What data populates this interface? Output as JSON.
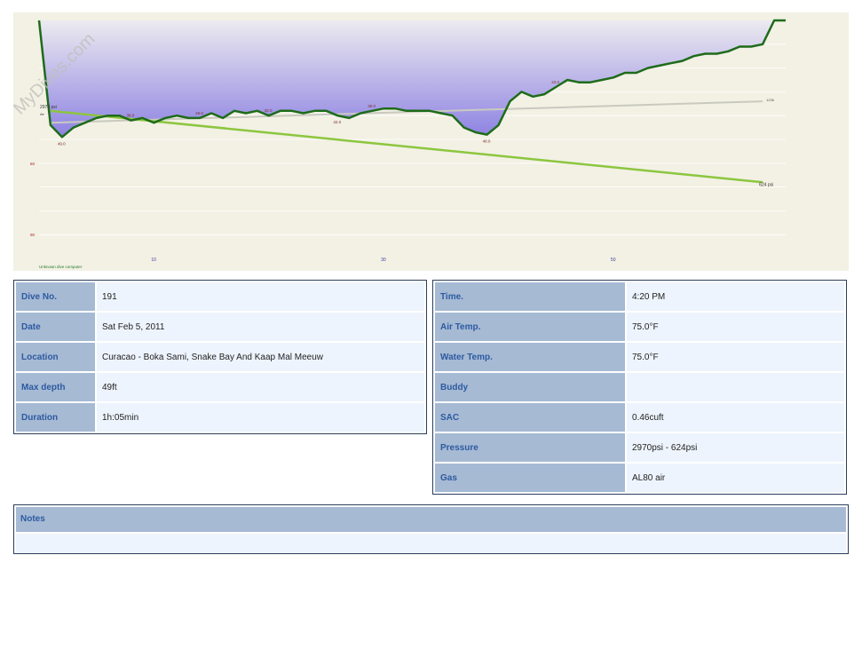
{
  "chart_data": {
    "type": "line",
    "title": "",
    "watermark": "MyDives.com",
    "device_label": "Unknown dive computer",
    "x_ticks": [
      "10",
      "30",
      "50"
    ],
    "y_ticks": [
      "60",
      "90"
    ],
    "depth_profile": {
      "x": [
        0,
        1,
        2,
        3,
        4,
        5,
        6,
        7,
        8,
        9,
        10,
        11,
        12,
        13,
        14,
        15,
        16,
        17,
        18,
        19,
        20,
        21,
        22,
        23,
        24,
        25,
        26,
        27,
        28,
        29,
        30,
        31,
        32,
        33,
        34,
        35,
        36,
        37,
        38,
        39,
        40,
        41,
        42,
        43,
        44,
        45,
        46,
        47,
        48,
        49,
        50,
        51,
        52,
        53,
        54,
        55,
        56,
        57,
        58,
        59,
        60,
        61,
        62,
        63,
        64,
        65
      ],
      "y": [
        0,
        44,
        49,
        45,
        43,
        41,
        40,
        40,
        42,
        41,
        43,
        41,
        40,
        41,
        41,
        39,
        41,
        38,
        39,
        38,
        40,
        38,
        38,
        39,
        38,
        38,
        40,
        41,
        39,
        38,
        37,
        37,
        38,
        38,
        38,
        39,
        40,
        45,
        47,
        48,
        44,
        34,
        30,
        32,
        31,
        28,
        25,
        26,
        26,
        25,
        24,
        22,
        22,
        20,
        19,
        18,
        17,
        15,
        14,
        14,
        13,
        11,
        11,
        10,
        0,
        0
      ]
    },
    "depth_labels": [
      "49.0",
      "38.0",
      "29.0",
      "32.0",
      "42.0",
      "30.0",
      "48.0",
      "22.0"
    ],
    "pressure": {
      "start_label": "2970 psi",
      "start_sub": "Air",
      "end_label": "624 psi"
    },
    "reference_label": "1236"
  },
  "left_table": [
    {
      "label": "Dive No.",
      "value": "191"
    },
    {
      "label": "Date",
      "value": "Sat Feb 5, 2011"
    },
    {
      "label": "Location",
      "value": "Curacao - Boka Sami, Snake Bay And Kaap Mal Meeuw"
    },
    {
      "label": "Max depth",
      "value": "49ft"
    },
    {
      "label": "Duration",
      "value": "1h:05min"
    }
  ],
  "right_table": [
    {
      "label": "Time.",
      "value": "4:20 PM"
    },
    {
      "label": "Air Temp.",
      "value": "75.0°F"
    },
    {
      "label": "Water Temp.",
      "value": "75.0°F"
    },
    {
      "label": "Buddy",
      "value": ""
    },
    {
      "label": "SAC",
      "value": "0.46cuft"
    },
    {
      "label": "Pressure",
      "value": "2970psi - 624psi"
    },
    {
      "label": "Gas",
      "value": "AL80 air"
    }
  ],
  "notes": {
    "label": "Notes",
    "value": ""
  },
  "colors": {
    "depth_line": "#1e6b1a",
    "pressure_line": "#8cc63f",
    "fill_top": "#e8e8f0",
    "fill_bottom": "#8e84e0",
    "panel_bg": "#f2f1e4"
  }
}
